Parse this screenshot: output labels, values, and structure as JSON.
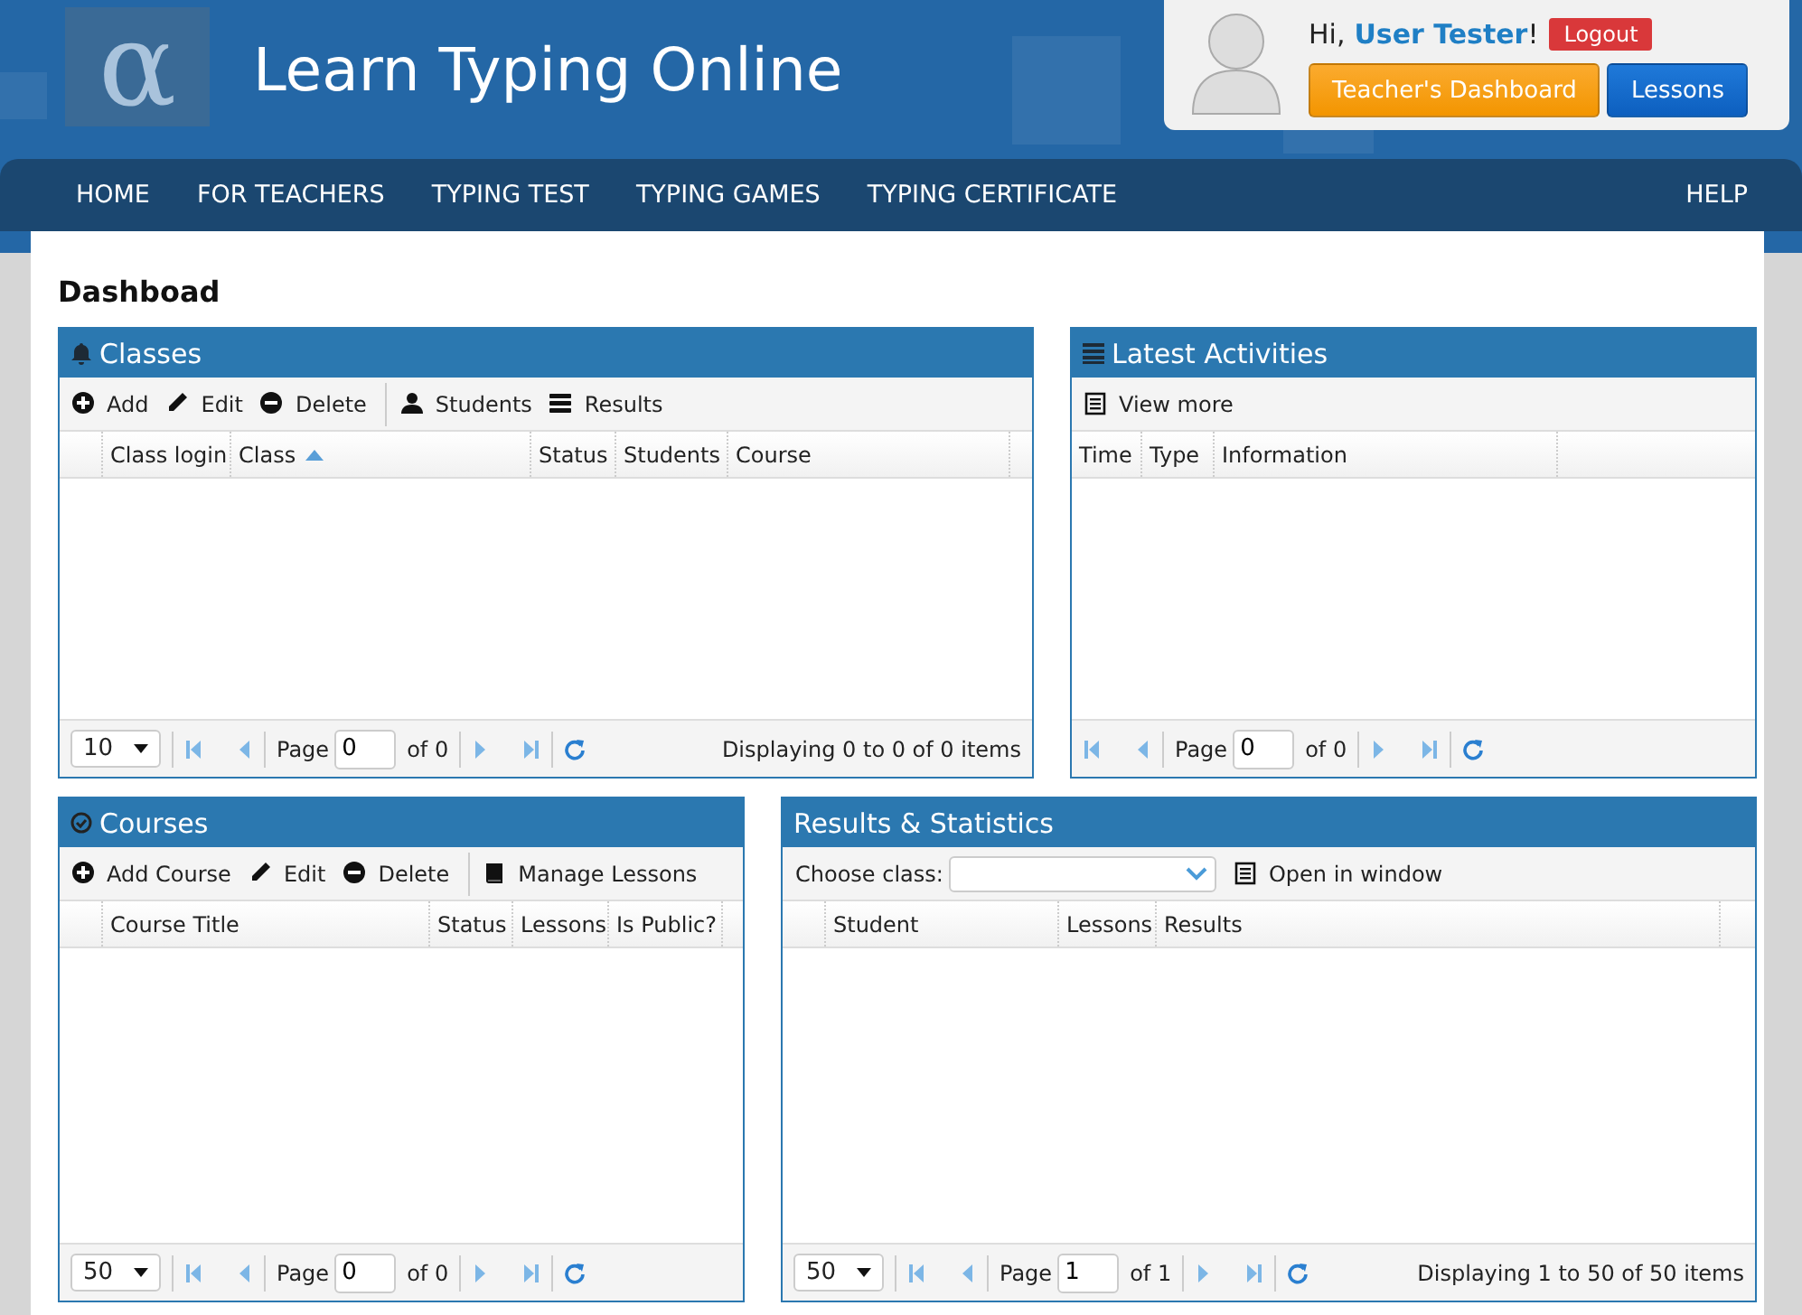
{
  "header": {
    "logo": "α",
    "title": "Learn Typing Online"
  },
  "user": {
    "greeting": "Hi,",
    "name": "User Tester",
    "exclaim": "!",
    "logout": "Logout",
    "buttons": [
      {
        "label": "Teacher's Dashboard",
        "kind": "orange"
      },
      {
        "label": "Lessons",
        "kind": "blue"
      }
    ]
  },
  "nav": {
    "items": [
      "HOME",
      "FOR TEACHERS",
      "TYPING TEST",
      "TYPING GAMES",
      "TYPING CERTIFICATE"
    ],
    "right_items": [
      "HELP"
    ]
  },
  "page_title": "Dashboad",
  "panels": [
    {
      "title": "Classes",
      "toolbar": [
        {
          "kind": "button",
          "label": "Add",
          "divider_before": false
        },
        {
          "kind": "button",
          "label": "Edit",
          "divider_before": false
        },
        {
          "kind": "button",
          "label": "Delete",
          "divider_before": false
        },
        {
          "kind": "button",
          "label": "Students",
          "divider_before": true
        },
        {
          "kind": "button",
          "label": "Results",
          "divider_before": false
        }
      ],
      "checkbox_column": true,
      "columns": [
        {
          "label": "Class login",
          "sorted": false
        },
        {
          "label": "Class",
          "sorted": true
        },
        {
          "label": "Status",
          "sorted": false
        },
        {
          "label": "Students",
          "sorted": false
        },
        {
          "label": "Course",
          "sorted": false
        }
      ],
      "pager": {
        "page_size": "10",
        "page_label": "Page",
        "page": "0",
        "of": "of 0",
        "display": "Displaying 0 to 0 of 0 items"
      }
    },
    {
      "title": "Latest Activities",
      "toolbar": [
        {
          "kind": "button",
          "label": "View more",
          "divider_before": false
        }
      ],
      "checkbox_column": false,
      "columns": [
        {
          "label": "Time",
          "sorted": false
        },
        {
          "label": "Type",
          "sorted": false
        },
        {
          "label": "Information",
          "sorted": false
        }
      ],
      "pager": {
        "page_label": "Page",
        "page": "0",
        "of": "of 0"
      }
    },
    {
      "title": "Courses",
      "toolbar": [
        {
          "kind": "button",
          "label": "Add Course",
          "divider_before": false
        },
        {
          "kind": "button",
          "label": "Edit",
          "divider_before": false
        },
        {
          "kind": "button",
          "label": "Delete",
          "divider_before": false
        },
        {
          "kind": "button",
          "label": "Manage Lessons",
          "divider_before": true
        }
      ],
      "checkbox_column": true,
      "columns": [
        {
          "label": "Course Title",
          "sorted": false
        },
        {
          "label": "Status",
          "sorted": false
        },
        {
          "label": "Lessons",
          "sorted": false
        },
        {
          "label": "Is Public?",
          "sorted": false
        }
      ],
      "pager": {
        "page_size": "50",
        "page_label": "Page",
        "page": "0",
        "of": "of 0"
      }
    },
    {
      "title": "Results & Statistics",
      "toolbar": [
        {
          "kind": "label",
          "label": "Choose class:",
          "divider_before": false
        },
        {
          "kind": "select"
        },
        {
          "kind": "button",
          "label": "Open in window",
          "divider_before": false
        }
      ],
      "checkbox_column": true,
      "columns": [
        {
          "label": "Student",
          "sorted": false
        },
        {
          "label": "Lessons",
          "sorted": false
        },
        {
          "label": "Results",
          "sorted": false
        }
      ],
      "pager": {
        "page_size": "50",
        "page_label": "Page",
        "page": "1",
        "of": "of 1",
        "display": "Displaying 1 to 50 of 50 items"
      }
    }
  ]
}
